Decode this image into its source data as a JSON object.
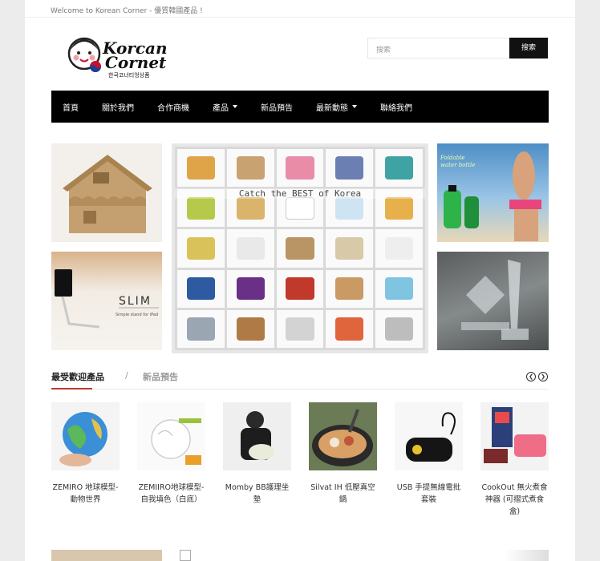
{
  "topbar": {
    "welcome": "Welcome to Korean Corner - 優質韓國產品 !"
  },
  "logo": {
    "line1": "Korcan",
    "line2": "Cornet",
    "korean": "한국코너티엉상품"
  },
  "search": {
    "placeholder": "搜索",
    "button": "搜索"
  },
  "nav": {
    "items": [
      {
        "label": "首頁"
      },
      {
        "label": "關於我們"
      },
      {
        "label": "合作商機"
      },
      {
        "label": "產品",
        "dropdown": true
      },
      {
        "label": "新品預告"
      },
      {
        "label": "最新動態",
        "dropdown": true
      },
      {
        "label": "聯絡我們"
      }
    ]
  },
  "banners": {
    "catch": "Catch the BEST of Korea",
    "slim": "SLIM",
    "slim_sub": "Simple stand for iPad",
    "bottle": "Foldable\nwater bottle"
  },
  "section": {
    "tab_popular": "最受歡迎產品",
    "slash": "/",
    "tab_new": "新品預告",
    "prev_icon": "chevron-left-icon",
    "next_icon": "chevron-right-icon"
  },
  "products": [
    {
      "name": "ZEMIRO 地球模型-動物世界"
    },
    {
      "name": "ZEMIIRO地球模型-自我填色（白底）"
    },
    {
      "name": "Momby BB護理坐墊"
    },
    {
      "name": "Silvat IH 低壓真空鍋"
    },
    {
      "name": "USB 手提無線電批套裝"
    },
    {
      "name": "CookOut 無火煮食神器 (可摺式煮食盒)"
    }
  ],
  "colors": {
    "nav_bg": "#000000",
    "accent": "#c0392b",
    "logo_red": "#c8102e"
  }
}
